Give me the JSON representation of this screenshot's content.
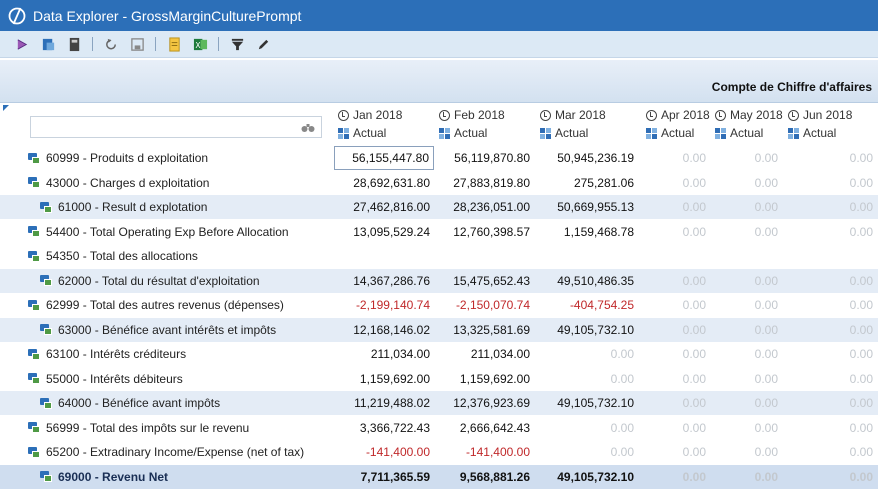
{
  "window": {
    "title": "Data Explorer - GrossMarginCulturePrompt"
  },
  "toolbar": {
    "icons": [
      "run-icon",
      "export-icon",
      "calculator-icon",
      "undo-icon",
      "save-icon",
      "document-icon",
      "excel-icon",
      "filter-icon",
      "pencil-icon"
    ]
  },
  "header": {
    "account_label": "Compte de Chiffre d'affaires"
  },
  "filter": {
    "value": ""
  },
  "columns": [
    {
      "period": "Jan 2018",
      "scenario": "Actual"
    },
    {
      "period": "Feb 2018",
      "scenario": "Actual"
    },
    {
      "period": "Mar 2018",
      "scenario": "Actual"
    },
    {
      "period": "Apr 2018",
      "scenario": "Actual"
    },
    {
      "period": "May 2018",
      "scenario": "Actual"
    },
    {
      "period": "Jun 2018",
      "scenario": "Actual"
    }
  ],
  "rows": [
    {
      "label": "60999 - Produits d exploitation",
      "values": [
        "56,155,447.80",
        "56,119,870.80",
        "50,945,236.19",
        "0.00",
        "0.00",
        "0.00"
      ]
    },
    {
      "label": "43000 - Charges d exploitation",
      "values": [
        "28,692,631.80",
        "27,883,819.80",
        "275,281.06",
        "0.00",
        "0.00",
        "0.00"
      ]
    },
    {
      "label": "61000 - Result d explotation",
      "values": [
        "27,462,816.00",
        "28,236,051.00",
        "50,669,955.13",
        "0.00",
        "0.00",
        "0.00"
      ]
    },
    {
      "label": "54400 - Total Operating Exp Before Allocation",
      "values": [
        "13,095,529.24",
        "12,760,398.57",
        "1,159,468.78",
        "0.00",
        "0.00",
        "0.00"
      ]
    },
    {
      "label": "54350 - Total des allocations",
      "values": [
        "",
        "",
        "",
        "",
        "",
        ""
      ]
    },
    {
      "label": "62000 - Total du résultat d'exploitation",
      "values": [
        "14,367,286.76",
        "15,475,652.43",
        "49,510,486.35",
        "0.00",
        "0.00",
        "0.00"
      ]
    },
    {
      "label": "62999 - Total des autres revenus (dépenses)",
      "values": [
        "-2,199,140.74",
        "-2,150,070.74",
        "-404,754.25",
        "0.00",
        "0.00",
        "0.00"
      ]
    },
    {
      "label": "63000 - Bénéfice avant intérêts et impôts",
      "values": [
        "12,168,146.02",
        "13,325,581.69",
        "49,105,732.10",
        "0.00",
        "0.00",
        "0.00"
      ]
    },
    {
      "label": "63100 - Intérêts créditeurs",
      "values": [
        "211,034.00",
        "211,034.00",
        "0.00",
        "0.00",
        "0.00",
        "0.00"
      ]
    },
    {
      "label": "55000 - Intérêts débiteurs",
      "values": [
        "1,159,692.00",
        "1,159,692.00",
        "0.00",
        "0.00",
        "0.00",
        "0.00"
      ]
    },
    {
      "label": "64000 - Bénéfice avant impôts",
      "values": [
        "11,219,488.02",
        "12,376,923.69",
        "49,105,732.10",
        "0.00",
        "0.00",
        "0.00"
      ]
    },
    {
      "label": "56999 - Total des impôts sur le revenu",
      "values": [
        "3,366,722.43",
        "2,666,642.43",
        "0.00",
        "0.00",
        "0.00",
        "0.00"
      ]
    },
    {
      "label": "65200 - Extradinary Income/Expense (net of tax)",
      "values": [
        "-141,400.00",
        "-141,400.00",
        "0.00",
        "0.00",
        "0.00",
        "0.00"
      ]
    },
    {
      "label": "69000 - Revenu Net",
      "values": [
        "7,711,365.59",
        "9,568,881.26",
        "49,105,732.10",
        "0.00",
        "0.00",
        "0.00"
      ]
    }
  ]
}
